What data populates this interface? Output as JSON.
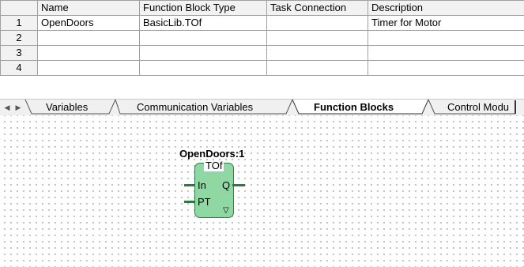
{
  "table": {
    "columns": [
      "Name",
      "Function Block Type",
      "Task Connection",
      "Description"
    ],
    "rows": [
      {
        "num": "1",
        "name": "OpenDoors",
        "type": "BasicLib.TOf",
        "task": "",
        "description": "Timer for Motor"
      },
      {
        "num": "2",
        "name": "",
        "type": "",
        "task": "",
        "description": ""
      },
      {
        "num": "3",
        "name": "",
        "type": "",
        "task": "",
        "description": ""
      },
      {
        "num": "4",
        "name": "",
        "type": "",
        "task": "",
        "description": ""
      }
    ]
  },
  "tabs": {
    "scroll_left": "◀",
    "scroll_right": "▶",
    "items": [
      {
        "label": "Variables",
        "active": false
      },
      {
        "label": "Communication Variables",
        "active": false
      },
      {
        "label": "Function Blocks",
        "active": true
      },
      {
        "label": "Control Modu",
        "active": false
      }
    ]
  },
  "function_block": {
    "instance_name": "OpenDoors:1",
    "type": "TOf",
    "inputs": [
      "In",
      "PT"
    ],
    "outputs": [
      "Q"
    ],
    "expand_glyph": "▽",
    "fill_color": "#8fd7a3",
    "border_color": "#2e7d4a"
  }
}
